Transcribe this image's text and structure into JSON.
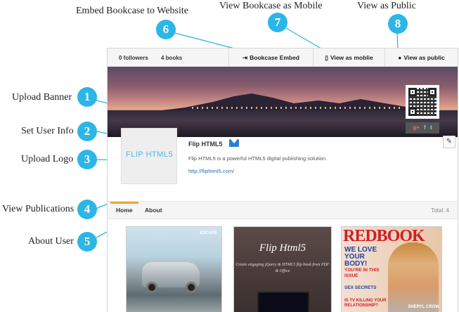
{
  "callouts": {
    "embed": "Embed Bookcase to Website",
    "mobile": "View Bookcase as Mobile",
    "public": "View as Public",
    "banner": "Upload Banner",
    "userinfo": "Set User Info",
    "logo": "Upload Logo",
    "publications": "View Publications",
    "about": "About User"
  },
  "badges": [
    "1",
    "2",
    "3",
    "4",
    "5",
    "6",
    "7",
    "8"
  ],
  "topbar": {
    "followers": "0 followers",
    "books": "4 books",
    "embed_label": "Bookcase Embed",
    "mobile_label": "View as moblie",
    "public_label": "View as public"
  },
  "banner": {
    "social": [
      "g+",
      "f",
      "t"
    ]
  },
  "profile": {
    "logo_text": "FLIP HTML5",
    "name": "Flip HTML5",
    "bio": "Flip HTML5 is a powerful HTML5 digital publishing solution.",
    "website": "http://fliphtml5.com/"
  },
  "tabs": {
    "home": "Home",
    "about": "About",
    "total": "Total: 4"
  },
  "publications": {
    "p1_tag": "ESCAPE",
    "p2_title": "Flip Html5",
    "p2_sub": "Create engaging jQuery & HTML5 flip book from PDF & Office",
    "p3_mast": "REDBOOK",
    "p3_h1": "WE LOVE YOUR BODY!",
    "p3_h2": "YOU'RE IN THIS ISSUE",
    "p3_h3": "SEX SECRETS",
    "p3_h4": "IS TV KILLING YOUR RELATIONSHIP?",
    "p3_corner": "SHERYL CROW"
  },
  "colors": {
    "badge": "#2cb6e8",
    "tab_accent": "#f0a830",
    "link": "#2b6fb3"
  }
}
